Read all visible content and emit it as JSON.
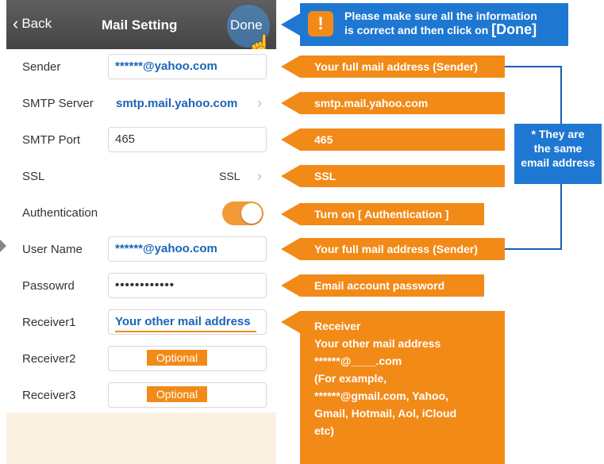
{
  "navbar": {
    "back_label": "Back",
    "title": "Mail Setting",
    "done_label": "Done"
  },
  "rows": [
    {
      "label": "Sender",
      "value": "******@yahoo.com"
    },
    {
      "label": "SMTP Server",
      "value": "smtp.mail.yahoo.com"
    },
    {
      "label": "SMTP Port",
      "value": "465"
    },
    {
      "label": "SSL",
      "value": "SSL"
    },
    {
      "label": "Authentication",
      "toggle_on": true
    },
    {
      "label": "User Name",
      "value": "******@yahoo.com"
    },
    {
      "label": "Passowrd",
      "value": "••••••••••••"
    },
    {
      "label": "Receiver1",
      "value": "Your other mail address"
    },
    {
      "label": "Receiver2",
      "value": "Optional"
    },
    {
      "label": "Receiver3",
      "value": "Optional"
    }
  ],
  "banner": {
    "line1": "Please make sure all the information",
    "line2": "is correct and then click on ",
    "done": "[Done]"
  },
  "annotations": [
    "Your full mail address (Sender)",
    "smtp.mail.yahoo.com",
    "465",
    "SSL",
    "Turn on [ Authentication ]",
    "Your full mail address (Sender)",
    "Email account password"
  ],
  "note": {
    "line1": "* They are",
    "line2": "the same",
    "line3": "email address"
  },
  "receiver_box": [
    "Receiver",
    "Your other mail address",
    "******@____.com",
    "(For example,",
    "******@gmail.com, Yahoo,",
    "Gmail, Hotmail, Aol, iCloud",
    "etc)"
  ],
  "colors": {
    "orange": "#f28a18",
    "blue": "#1e78d2",
    "navbar": "#4f4f4f"
  }
}
